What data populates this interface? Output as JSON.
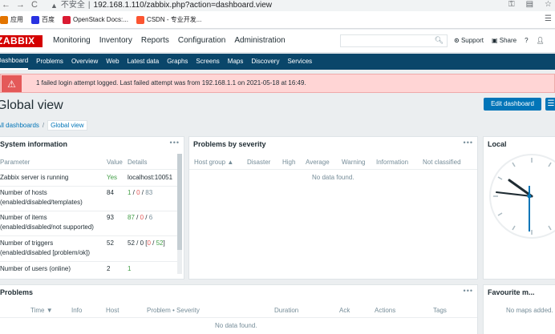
{
  "browser": {
    "back": "←",
    "forward": "→",
    "reload": "C",
    "security_label": "不安全",
    "url": "192.168.1.110/zabbix.php?action=dashboard.view",
    "bookmarks": [
      {
        "label": "应用",
        "color": "#e37400"
      },
      {
        "label": "百度",
        "color": "#2932e1"
      },
      {
        "label": "OpenStack Docs:...",
        "color": "#da1a32"
      },
      {
        "label": "CSDN - 专业开发...",
        "color": "#fc5531"
      }
    ]
  },
  "header": {
    "logo": "ZABBIX",
    "menu": [
      "Monitoring",
      "Inventory",
      "Reports",
      "Configuration",
      "Administration"
    ],
    "support": "Support",
    "share": "Share",
    "help": "?"
  },
  "subnav": [
    "Dashboard",
    "Problems",
    "Overview",
    "Web",
    "Latest data",
    "Graphs",
    "Screens",
    "Maps",
    "Discovery",
    "Services"
  ],
  "banner": {
    "text": "1 failed login attempt logged. Last failed attempt was from 192.168.1.1 on 2021-05-18 at 16:49."
  },
  "page": {
    "title": "Global view",
    "edit_button": "Edit dashboard",
    "breadcrumb_parent": "All dashboards",
    "breadcrumb_sep": "/",
    "breadcrumb_current": "Global view"
  },
  "system_info": {
    "title": "System information",
    "headers": [
      "Parameter",
      "Value",
      "Details"
    ],
    "rows": [
      {
        "param": "Zabbix server is running",
        "value": "Yes",
        "details": "localhost:10051"
      },
      {
        "param1": "Number of hosts",
        "param2": "(enabled/disabled/templates)",
        "value": "84",
        "d1": "1",
        "d2": "0",
        "d3": "83"
      },
      {
        "param1": "Number of items",
        "param2": "(enabled/disabled/not supported)",
        "value": "93",
        "d1": "87",
        "d2": "0",
        "d3": "6"
      },
      {
        "param1": "Number of triggers",
        "param2": "(enabled/disabled [problem/ok])",
        "value": "52",
        "d1": "52 / 0 [",
        "d2": "0",
        "d3": "52",
        "d4": "]"
      },
      {
        "param": "Number of users (online)",
        "value": "2",
        "details": "1"
      }
    ]
  },
  "problems_by_severity": {
    "title": "Problems by severity",
    "headers": [
      "Host group ▲",
      "Disaster",
      "High",
      "Average",
      "Warning",
      "Information",
      "Not classified"
    ],
    "empty": "No data found."
  },
  "clock": {
    "title": "Local"
  },
  "problems": {
    "title": "Problems",
    "headers": [
      "Time ▼",
      "Info",
      "Host",
      "Problem • Severity",
      "Duration",
      "Ack",
      "Actions",
      "Tags"
    ],
    "empty": "No data found."
  },
  "favourite_maps": {
    "title": "Favourite m...",
    "empty": "No maps added."
  },
  "colors": {
    "brand_red": "#d40000",
    "nav_blue": "#0a466a",
    "accent_blue": "#0275b8",
    "ok_green": "#429e47",
    "problem_red": "#e45959"
  }
}
